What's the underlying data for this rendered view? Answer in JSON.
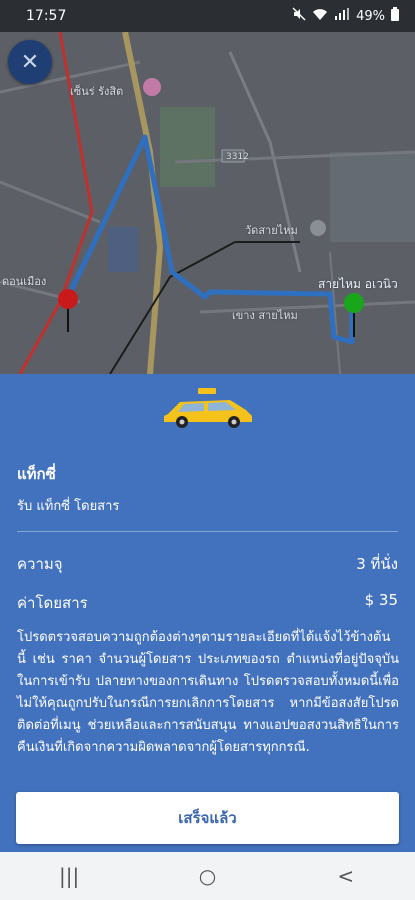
{
  "status_bar": {
    "time": "17:57",
    "battery": "49%",
    "icons": [
      "mute-icon",
      "wifi-icon",
      "signal-icon",
      "battery-icon"
    ]
  },
  "map": {
    "labels": {
      "l1": "เซ็นร่ รังสิต",
      "l2": "วัดสายไหม",
      "l3": "สายไหม อเวนิว",
      "l4": "ดอนเมือง",
      "l5": "เขาง สายไหม",
      "l6": "3312"
    },
    "pins": {
      "origin_color": "#c81a1a",
      "destination_color": "#1aa61a"
    },
    "route_color": "#2f6fbf"
  },
  "sheet": {
    "title": "แท็กซี่",
    "subtitle": "รับ แท็กซี่ โดยสาร",
    "capacity_label": "ความจุ",
    "capacity_value": "3 ที่นั่ง",
    "fare_label": "ค่าโดยสาร",
    "fare_value": "$ 35",
    "notice": "โปรดตรวจสอบความถูกต้องต่างๆตามรายละเอียดที่ได้แจ้งไว้ข้างต้นนี้ เช่น ราคา จำนวนผู้โดยสาร ประเภทของรถ ตำแหน่งที่อยู่ปัจจุบันในการเข้ารับ ปลายทางของการเดินทาง โปรดตรวจสอบทั้งหมดนี้เพื่อไม่ให้คุณถูกปรับในกรณีการยกเลิกการโดยสาร หากมีข้อสงสัยโปรดติดต่อที่เมนู ช่วยเหลือและการสนับสนุน ทางแอปขอสงวนสิทธิในการคืนเงินที่เกิดจากความผิดพลาดจากผู้โดยสารทุกกรณี.",
    "done_label": "เสร็จแล้ว",
    "accent": "#4272bd"
  },
  "nav": {
    "recents": "|||",
    "home": "○",
    "back": "<"
  }
}
